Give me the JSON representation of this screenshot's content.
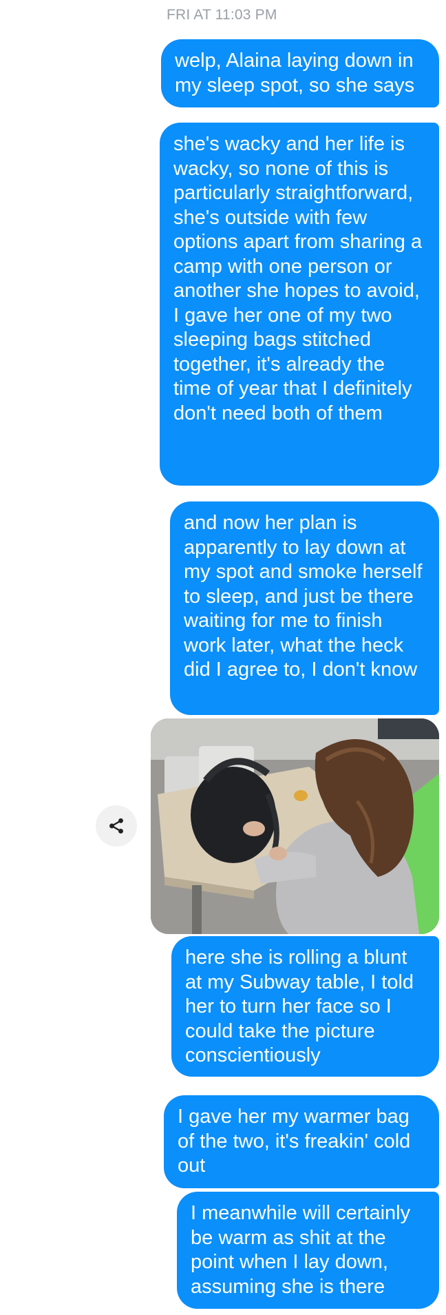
{
  "thread": {
    "timestamp": "FRI AT 11:03 PM"
  },
  "messages": [
    {
      "id": "m1",
      "type": "text",
      "text": "welp, Alaina laying down in my sleep spot, so she says"
    },
    {
      "id": "m2",
      "type": "text",
      "text": "she's wacky and her life is wacky, so none of this is particularly straightforward, she's outside with few options apart from sharing a camp with one person or another she hopes to avoid, I gave her one of my two sleeping bags stitched together, it's already the time of year that I definitely don't need both of them"
    },
    {
      "id": "m3",
      "type": "text",
      "text": "and now her plan is apparently to lay down at my spot and smoke herself to sleep, and just be there waiting for me to finish work later, what the heck did I agree to, I don't know"
    },
    {
      "id": "m4",
      "type": "photo"
    },
    {
      "id": "m5",
      "type": "text",
      "text": "here she is rolling a blunt at my Subway table, I told her to turn her face so I could take the picture conscientiously"
    },
    {
      "id": "m6",
      "type": "text",
      "text": "I gave her my warmer bag of the two, it's freakin' cold out"
    },
    {
      "id": "m7",
      "type": "text",
      "text": "I meanwhile will certainly be warm as shit at the point when I lay down, assuming she is there"
    }
  ],
  "icons": {
    "share": "share-icon"
  },
  "colors": {
    "outgoing_bubble": "#0a8ffb",
    "bubble_text": "#ffffff",
    "timestamp_text": "#9aa0a6",
    "share_button_bg": "#f1f1f1"
  }
}
